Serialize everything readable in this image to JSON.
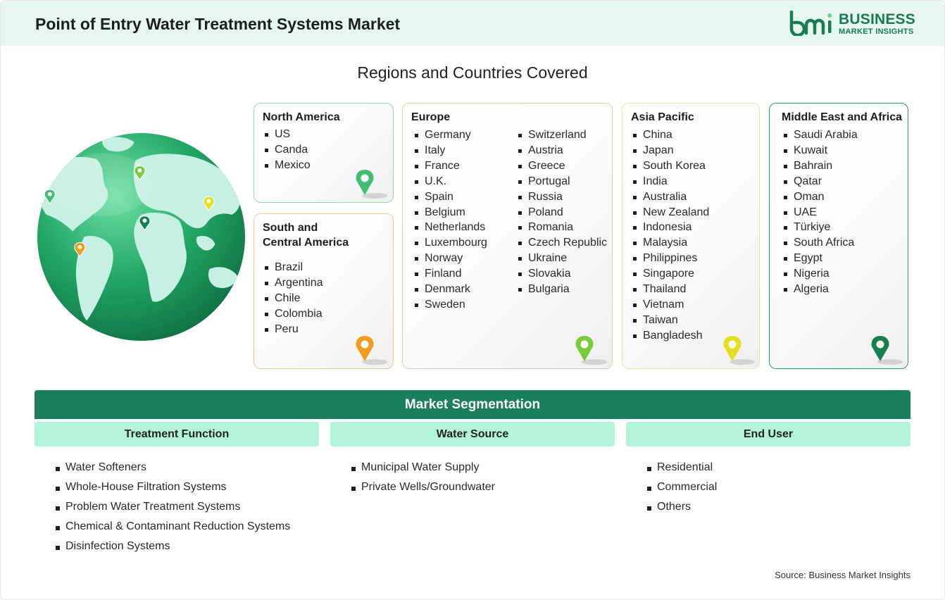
{
  "header": {
    "title": "Point of Entry Water Treatment Systems Market",
    "logo_line1": "BUSINESS",
    "logo_line2": "MARKET INSIGHTS",
    "logo_mark": "bmi"
  },
  "regions_title": "Regions and Countries Covered",
  "regions": {
    "north_america": {
      "title": "North America",
      "countries": [
        "US",
        "Canda",
        "Mexico"
      ],
      "pin_color": "#3fbf74"
    },
    "south_central_america": {
      "title_line1": "South and",
      "title_line2": "Central America",
      "countries": [
        "Brazil",
        "Argentina",
        "Chile",
        "Colombia",
        "Peru"
      ],
      "pin_color": "#f29b1d"
    },
    "europe": {
      "title": "Europe",
      "countries_col1": [
        "Germany",
        "Italy",
        "France",
        "U.K.",
        "Spain",
        "Belgium",
        "Netherlands",
        "Luxembourg",
        "Norway",
        "Finland",
        "Denmark",
        "Sweden"
      ],
      "countries_col2": [
        "Switzerland",
        "Austria",
        "Greece",
        "Portugal",
        "Russia",
        "Poland",
        "Romania",
        "Czech Republic",
        "Ukraine",
        "Slovakia",
        "Bulgaria"
      ],
      "pin_color": "#7acb3a"
    },
    "asia_pacific": {
      "title": "Asia Pacific",
      "countries": [
        "China",
        "Japan",
        "South Korea",
        "India",
        "Australia",
        "New Zealand",
        "Indonesia",
        "Malaysia",
        "Philippines",
        "Singapore",
        "Thailand",
        "Vietnam",
        "Taiwan",
        "Bangladesh"
      ],
      "pin_color": "#e6df1e"
    },
    "middle_east_africa": {
      "title": "Middle East and Africa",
      "countries": [
        "Saudi Arabia",
        "Kuwait",
        "Bahrain",
        "Qatar",
        "Oman",
        "UAE",
        "Türkiye",
        "South Africa",
        "Egypt",
        "Nigeria",
        "Algeria"
      ],
      "pin_color": "#15804c"
    }
  },
  "segmentation": {
    "title": "Market Segmentation",
    "columns": [
      {
        "heading": "Treatment Function",
        "items": [
          "Water Softeners",
          "Whole-House Filtration Systems",
          "Problem Water Treatment Systems",
          "Chemical & Contaminant Reduction Systems",
          "Disinfection Systems"
        ]
      },
      {
        "heading": "Water Source",
        "items": [
          "Municipal Water Supply",
          "Private Wells/Groundwater"
        ]
      },
      {
        "heading": "End User",
        "items": [
          "Residential",
          "Commercial",
          "Others"
        ]
      }
    ]
  },
  "source": "Source: Business Market Insights",
  "colors": {
    "brand_green": "#1a7e5f",
    "header_bg": "#e5f7ef",
    "segment_head_bg": "#b2f5d9"
  }
}
